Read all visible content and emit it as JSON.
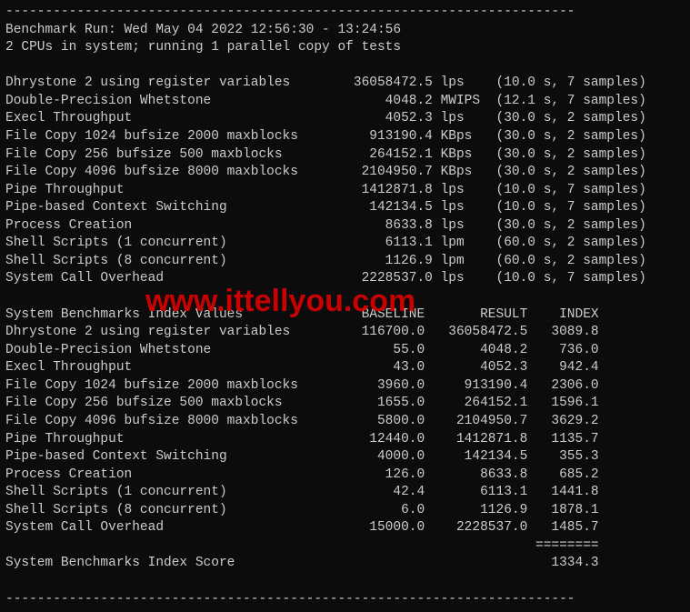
{
  "header": {
    "sep": "------------------------------------------------------------------------",
    "run_line": "Benchmark Run: Wed May 04 2022 12:56:30 - 13:24:56",
    "cpu_line": "2 CPUs in system; running 1 parallel copy of tests"
  },
  "results": [
    {
      "name": "Dhrystone 2 using register variables",
      "value": "36058472.5",
      "unit": "lps",
      "time": "10.0",
      "samples": "7"
    },
    {
      "name": "Double-Precision Whetstone",
      "value": "4048.2",
      "unit": "MWIPS",
      "time": "12.1",
      "samples": "7"
    },
    {
      "name": "Execl Throughput",
      "value": "4052.3",
      "unit": "lps",
      "time": "30.0",
      "samples": "2"
    },
    {
      "name": "File Copy 1024 bufsize 2000 maxblocks",
      "value": "913190.4",
      "unit": "KBps",
      "time": "30.0",
      "samples": "2"
    },
    {
      "name": "File Copy 256 bufsize 500 maxblocks",
      "value": "264152.1",
      "unit": "KBps",
      "time": "30.0",
      "samples": "2"
    },
    {
      "name": "File Copy 4096 bufsize 8000 maxblocks",
      "value": "2104950.7",
      "unit": "KBps",
      "time": "30.0",
      "samples": "2"
    },
    {
      "name": "Pipe Throughput",
      "value": "1412871.8",
      "unit": "lps",
      "time": "10.0",
      "samples": "7"
    },
    {
      "name": "Pipe-based Context Switching",
      "value": "142134.5",
      "unit": "lps",
      "time": "10.0",
      "samples": "7"
    },
    {
      "name": "Process Creation",
      "value": "8633.8",
      "unit": "lps",
      "time": "30.0",
      "samples": "2"
    },
    {
      "name": "Shell Scripts (1 concurrent)",
      "value": "6113.1",
      "unit": "lpm",
      "time": "60.0",
      "samples": "2"
    },
    {
      "name": "Shell Scripts (8 concurrent)",
      "value": "1126.9",
      "unit": "lpm",
      "time": "60.0",
      "samples": "2"
    },
    {
      "name": "System Call Overhead",
      "value": "2228537.0",
      "unit": "lps",
      "time": "10.0",
      "samples": "7"
    }
  ],
  "index_header": {
    "title": "System Benchmarks Index Values",
    "c1": "BASELINE",
    "c2": "RESULT",
    "c3": "INDEX"
  },
  "index": [
    {
      "name": "Dhrystone 2 using register variables",
      "baseline": "116700.0",
      "result": "36058472.5",
      "index": "3089.8"
    },
    {
      "name": "Double-Precision Whetstone",
      "baseline": "55.0",
      "result": "4048.2",
      "index": "736.0"
    },
    {
      "name": "Execl Throughput",
      "baseline": "43.0",
      "result": "4052.3",
      "index": "942.4"
    },
    {
      "name": "File Copy 1024 bufsize 2000 maxblocks",
      "baseline": "3960.0",
      "result": "913190.4",
      "index": "2306.0"
    },
    {
      "name": "File Copy 256 bufsize 500 maxblocks",
      "baseline": "1655.0",
      "result": "264152.1",
      "index": "1596.1"
    },
    {
      "name": "File Copy 4096 bufsize 8000 maxblocks",
      "baseline": "5800.0",
      "result": "2104950.7",
      "index": "3629.2"
    },
    {
      "name": "Pipe Throughput",
      "baseline": "12440.0",
      "result": "1412871.8",
      "index": "1135.7"
    },
    {
      "name": "Pipe-based Context Switching",
      "baseline": "4000.0",
      "result": "142134.5",
      "index": "355.3"
    },
    {
      "name": "Process Creation",
      "baseline": "126.0",
      "result": "8633.8",
      "index": "685.2"
    },
    {
      "name": "Shell Scripts (1 concurrent)",
      "baseline": "42.4",
      "result": "6113.1",
      "index": "1441.8"
    },
    {
      "name": "Shell Scripts (8 concurrent)",
      "baseline": "6.0",
      "result": "1126.9",
      "index": "1878.1"
    },
    {
      "name": "System Call Overhead",
      "baseline": "15000.0",
      "result": "2228537.0",
      "index": "1485.7"
    }
  ],
  "footer": {
    "rule": "                                                                   ========",
    "label": "System Benchmarks Index Score",
    "score": "1334.3"
  },
  "watermark": "www.ittellyou.com"
}
